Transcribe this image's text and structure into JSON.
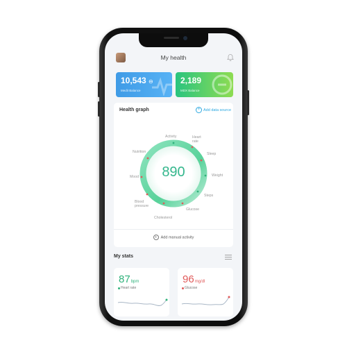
{
  "header": {
    "title": "My health"
  },
  "balances": [
    {
      "value": "10,543",
      "label": "Medit Balance",
      "color": "#3f9be6"
    },
    {
      "value": "2,189",
      "label": "MDX Balance",
      "color": "#2ac47f"
    }
  ],
  "health_graph": {
    "title": "Health graph",
    "add_source": "Add data source",
    "score": "890",
    "metrics": [
      "Activity",
      "Heart rate",
      "Sleep",
      "Weight",
      "Steps",
      "Glucose",
      "Cholesterol",
      "Blood pressure",
      "Mood",
      "Nutrition"
    ],
    "add_manual": "Add manual activity"
  },
  "stats": {
    "title": "My stats",
    "items": [
      {
        "value": "87",
        "unit": "bpm",
        "name": "Heart rate",
        "color": "#2fb27b"
      },
      {
        "value": "96",
        "unit": "mg/dl",
        "name": "Glucose",
        "color": "#e05a5a"
      }
    ]
  },
  "icons": [
    "avatar",
    "bell-icon",
    "menu-icon",
    "plus-circle-icon"
  ]
}
